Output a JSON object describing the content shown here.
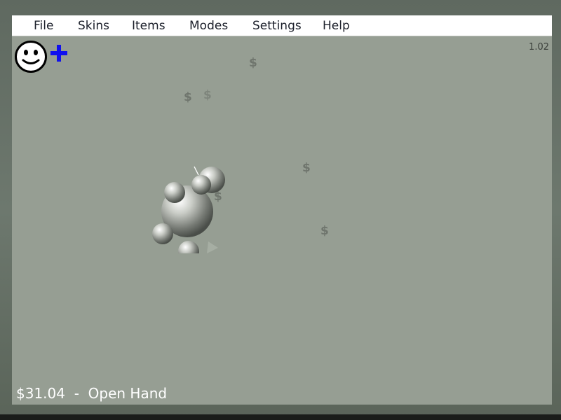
{
  "menu": {
    "items": [
      "File",
      "Skins",
      "Items",
      "Modes",
      "Settings",
      "Help"
    ]
  },
  "version": "1.02",
  "icons": {
    "smiley": "smiley-face-icon",
    "plus": "plus-icon",
    "accent_color": "#1010ee"
  },
  "coins": {
    "symbol": "$"
  },
  "status": {
    "money": "$31.04",
    "separator": "-",
    "tool": "Open Hand"
  },
  "colors": {
    "playfield": "#969e93",
    "menubar": "#ffffff",
    "status_text": "#ffffff"
  }
}
